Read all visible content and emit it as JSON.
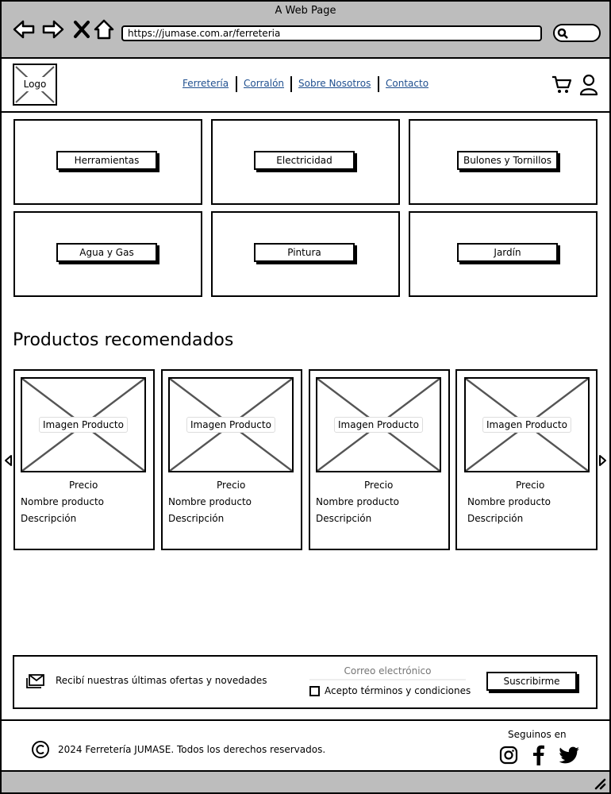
{
  "browser": {
    "title": "A Web Page",
    "url": "https://jumase.com.ar/ferreteria"
  },
  "header": {
    "logo_label": "Logo",
    "nav": [
      "Ferretería",
      "Corralón",
      "Sobre Nosotros",
      "Contacto"
    ]
  },
  "categories": [
    "Herramientas",
    "Electricidad",
    "Bulones y Tornillos",
    "Agua y Gas",
    "Pintura",
    "Jardín"
  ],
  "recommended": {
    "title": "Productos recomendados",
    "products": [
      {
        "image_label": "Imagen Producto",
        "price": "Precio",
        "name": "Nombre producto",
        "description": "Descripción"
      },
      {
        "image_label": "Imagen Producto",
        "price": "Precio",
        "name": "Nombre producto",
        "description": "Descripción"
      },
      {
        "image_label": "Imagen Producto",
        "price": "Precio",
        "name": "Nombre producto",
        "description": "Descripción"
      },
      {
        "image_label": "Imagen Producto",
        "price": "Precio",
        "name": "Nombre producto",
        "description": "Descripción"
      }
    ]
  },
  "newsletter": {
    "text": "Recibí nuestras últimas ofertas y novedades",
    "email_placeholder": "Correo electrónico",
    "terms_label": "Acepto términos y condiciones",
    "subscribe_label": "Suscribirme"
  },
  "footer": {
    "copyright": "2024 Ferretería JUMASE. Todos los derechos reservados.",
    "follow_label": "Seguinos en",
    "social": [
      "instagram-icon",
      "facebook-icon",
      "twitter-icon"
    ]
  },
  "colors": {
    "chrome": "#bdbdbd",
    "link": "#1f4f8f"
  }
}
